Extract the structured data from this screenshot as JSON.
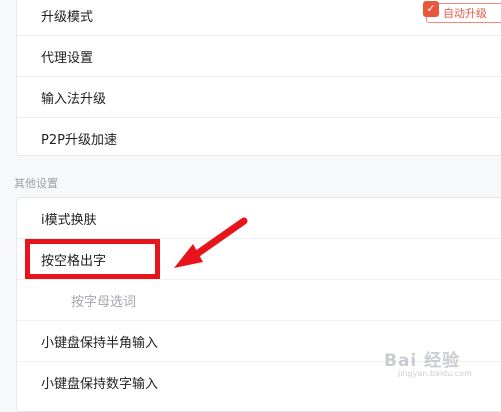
{
  "top_settings": {
    "items": [
      {
        "label": "升级模式"
      },
      {
        "label": "代理设置"
      },
      {
        "label": "输入法升级"
      },
      {
        "label": "P2P升级加速"
      }
    ],
    "auto_upgrade_badge": "自动升级"
  },
  "other_settings": {
    "title": "其他设置",
    "items": [
      {
        "label": "i模式换肤"
      },
      {
        "label": "按空格出字"
      },
      {
        "label": "按字母选词"
      },
      {
        "label": "小键盘保持半角输入"
      },
      {
        "label": "小键盘保持数字输入"
      }
    ]
  },
  "annotation": {
    "color": "#e8141b"
  },
  "watermark": {
    "main": "Bai 经验",
    "sub": "jingyan.baidu.com"
  }
}
